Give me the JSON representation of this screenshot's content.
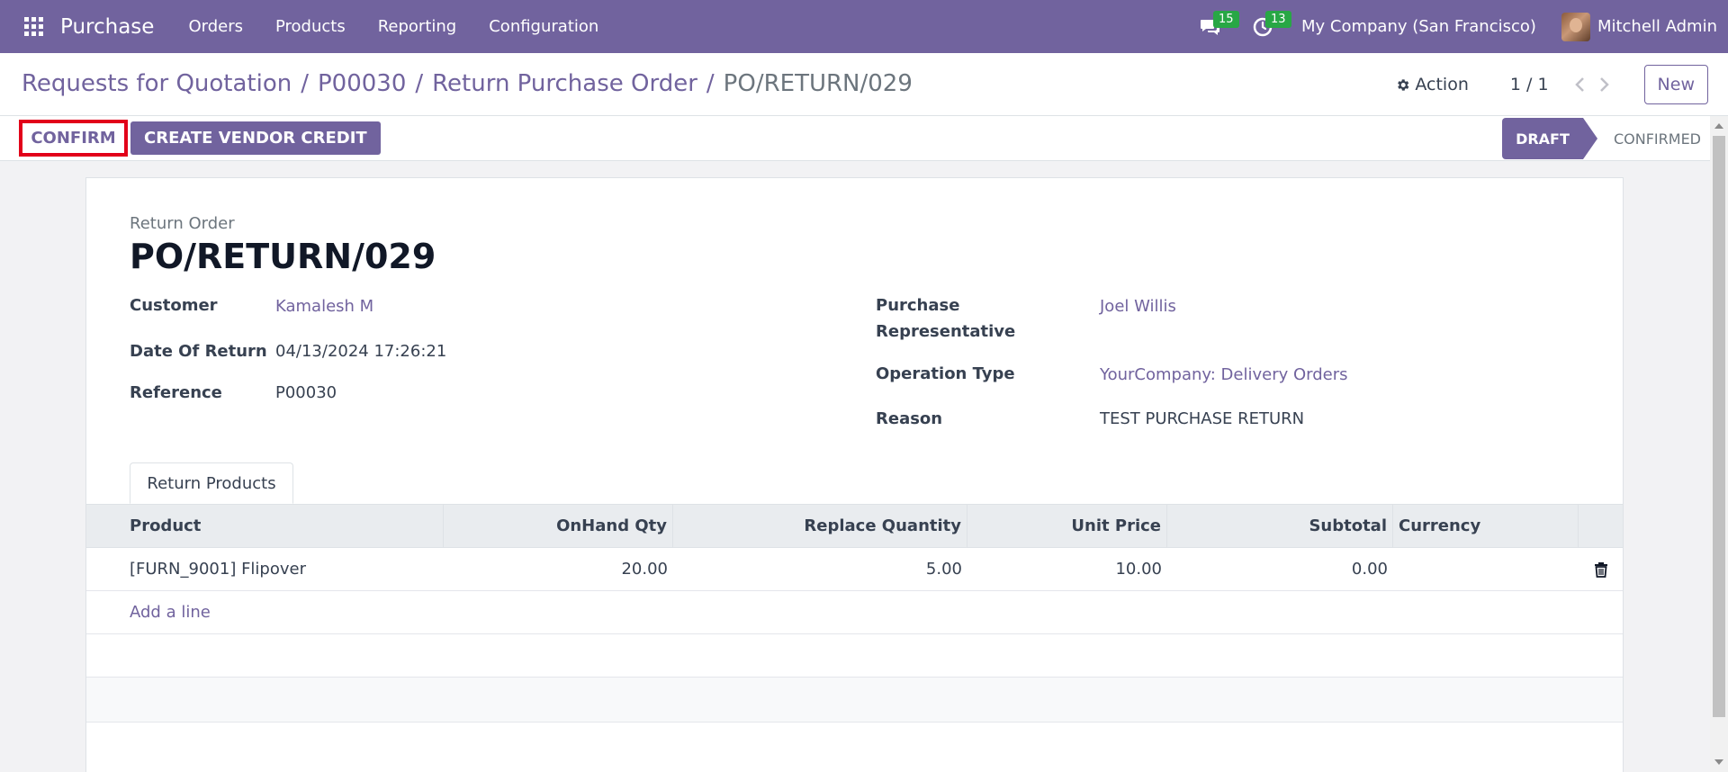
{
  "navbar": {
    "brand": "Purchase",
    "menu": [
      "Orders",
      "Products",
      "Reporting",
      "Configuration"
    ],
    "messages_count": "15",
    "activities_count": "13",
    "company": "My Company (San Francisco)",
    "user": "Mitchell Admin"
  },
  "breadcrumb": {
    "items": [
      "Requests for Quotation",
      "P00030",
      "Return Purchase Order"
    ],
    "separator": "/",
    "current": "PO/RETURN/029"
  },
  "control": {
    "action_label": "Action",
    "pager": "1 / 1",
    "new_label": "New"
  },
  "statusbar": {
    "confirm_label": "CONFIRM",
    "vendor_credit_label": "CREATE VENDOR CREDIT",
    "stages": [
      "DRAFT",
      "CONFIRMED"
    ],
    "active_stage": "DRAFT"
  },
  "form": {
    "title_label": "Return Order",
    "title": "PO/RETURN/029",
    "left_fields": [
      {
        "label": "Customer",
        "value": "Kamalesh M"
      },
      {
        "label": "Date Of Return",
        "value": "04/13/2024 17:26:21"
      },
      {
        "label": "Reference",
        "value": "P00030"
      }
    ],
    "right_fields": [
      {
        "label": "Purchase Representative",
        "value": "Joel Willis"
      },
      {
        "label": "Operation Type",
        "value": "YourCompany: Delivery Orders"
      },
      {
        "label": "Reason",
        "value": "TEST PURCHASE RETURN"
      }
    ]
  },
  "tab": {
    "label": "Return Products"
  },
  "table": {
    "columns": [
      "Product",
      "OnHand Qty",
      "Replace Quantity",
      "Unit Price",
      "Subtotal",
      "Currency"
    ],
    "rows": [
      {
        "product": "[FURN_9001] Flipover",
        "onhand": "20.00",
        "replace_qty": "5.00",
        "unit_price": "10.00",
        "subtotal": "0.00",
        "currency": ""
      }
    ],
    "add_line": "Add a line"
  },
  "colors": {
    "brand": "#71639e",
    "badge": "#28a745",
    "highlight": "#e2001a"
  }
}
